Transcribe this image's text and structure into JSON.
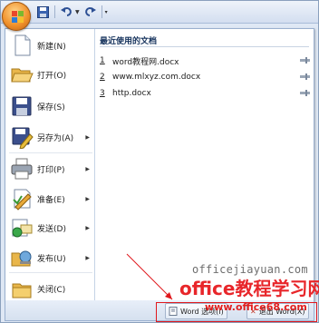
{
  "qat": {
    "save_icon": "save-icon",
    "undo_icon": "undo-icon",
    "redo_icon": "redo-icon"
  },
  "menu": {
    "items": [
      {
        "label": "新建(N)",
        "icon": "new-document-icon"
      },
      {
        "label": "打开(O)",
        "icon": "open-folder-icon"
      },
      {
        "label": "保存(S)",
        "icon": "save-icon"
      },
      {
        "label": "另存为(A)",
        "icon": "save-as-icon",
        "arrow": "▶"
      },
      {
        "label": "打印(P)",
        "icon": "printer-icon",
        "arrow": "▶"
      },
      {
        "label": "准备(E)",
        "icon": "prepare-icon",
        "arrow": "▶"
      },
      {
        "label": "发送(D)",
        "icon": "send-icon",
        "arrow": "▶"
      },
      {
        "label": "发布(U)",
        "icon": "publish-icon",
        "arrow": "▶"
      },
      {
        "label": "关闭(C)",
        "icon": "close-folder-icon"
      }
    ]
  },
  "recent": {
    "title": "最近使用的文档",
    "docs": [
      {
        "num": "1",
        "name": "word教程网.docx"
      },
      {
        "num": "2",
        "name": "www.mlxyz.com.docx"
      },
      {
        "num": "3",
        "name": "http.docx"
      }
    ]
  },
  "bottom": {
    "options_label": "Word 选项(I)",
    "exit_label": "退出 Word(X)"
  },
  "watermark": {
    "site": "officejiayuan.com",
    "brand": "office教程学习网",
    "url": "www.office68.com"
  },
  "colors": {
    "highlight": "#e0171c",
    "orb": "#f0902a"
  }
}
